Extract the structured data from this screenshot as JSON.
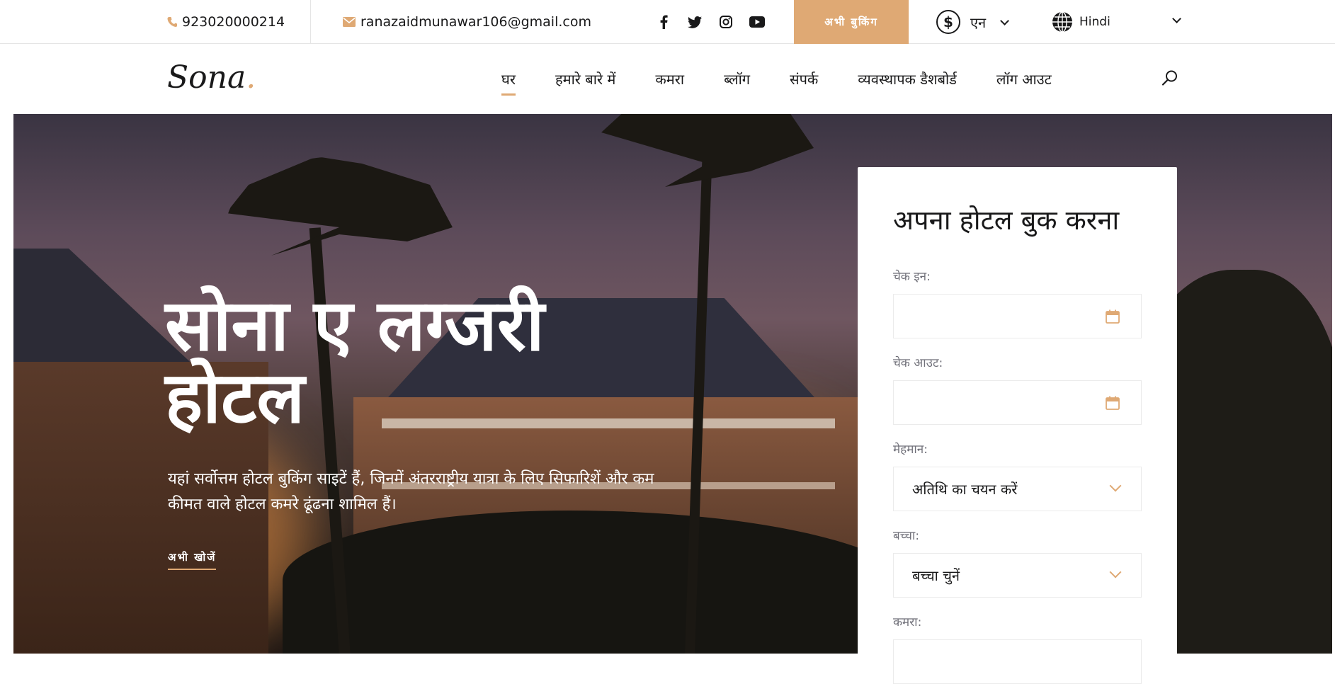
{
  "topbar": {
    "phone": "923020000214",
    "email": "ranazaidmunawar106@gmail.com",
    "socials": [
      "facebook-icon",
      "twitter-icon",
      "instagram-icon",
      "youtube-icon"
    ],
    "book_button": "अभी बुकिंग",
    "currency_label": "एन",
    "language": "Hindi"
  },
  "nav": {
    "logo": "Sona",
    "logo_dot": ".",
    "items": [
      "घर",
      "हमारे बारे में",
      "कमरा",
      "ब्लॉग",
      "संपर्क",
      "व्यवस्थापक डैशबोर्ड",
      "लॉग आउट"
    ],
    "active_index": 0
  },
  "hero": {
    "title": "सोना ए लग्जरी होटल",
    "description": "यहां सर्वोत्तम होटल बुकिंग साइटें हैं, जिनमें अंतरराष्ट्रीय यात्रा के लिए सिफारिशें और कम कीमत वाले होटल कमरे ढूंढना शामिल हैं।",
    "cta": "अभी खोजें"
  },
  "booking": {
    "title": "अपना होटल बुक करना",
    "check_in_label": "चेक इन:",
    "check_out_label": "चेक आउट:",
    "guests_label": "मेहमान:",
    "guests_value": "अतिथि का चयन करें",
    "children_label": "बच्चा:",
    "children_value": "बच्चा चुनें",
    "rooms_label": "कमरा:"
  },
  "colors": {
    "accent": "#dfa974",
    "text": "#19191a",
    "muted": "#707079"
  }
}
